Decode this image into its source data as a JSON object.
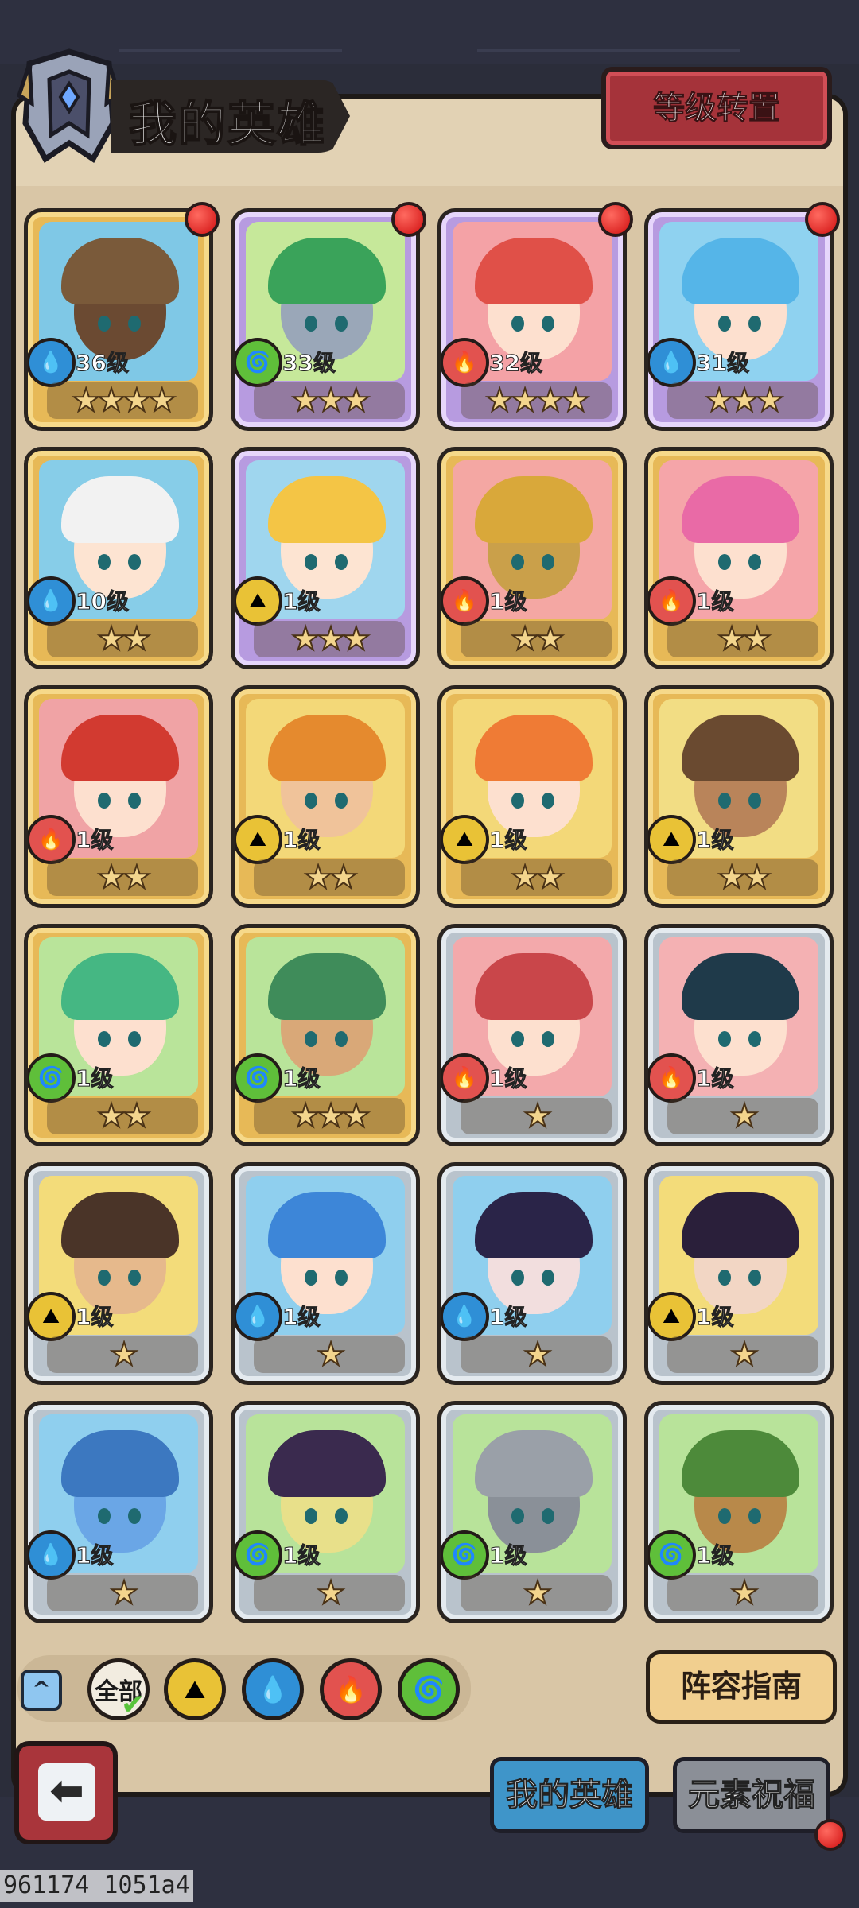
{
  "header": {
    "title": "我的英雄",
    "reset_button_label": "等级转置"
  },
  "elements": {
    "water": {
      "icon": "water-drop-icon",
      "color": "#2f8fd6",
      "glyph": "💧"
    },
    "wind": {
      "icon": "wind-swirl-icon",
      "color": "#5fbf3a",
      "glyph": "🌀"
    },
    "fire": {
      "icon": "fire-flame-icon",
      "color": "#e2524f",
      "glyph": "🔥"
    },
    "earth": {
      "icon": "earth-mound-icon",
      "color": "#e9c236",
      "glyph": "⛰"
    }
  },
  "heroes": [
    {
      "level": "36级",
      "stars": 4,
      "element": "water",
      "frame": "gold",
      "notify": true,
      "hair": "#7a5a3a",
      "bg": "#7fc8e6",
      "skin": "#6b4a32"
    },
    {
      "level": "33级",
      "stars": 3,
      "element": "wind",
      "frame": "purple",
      "notify": true,
      "hair": "#3aa35a",
      "bg": "#c6e89a",
      "skin": "#9aa7b8"
    },
    {
      "level": "32级",
      "stars": 4,
      "element": "fire",
      "frame": "purple",
      "notify": true,
      "hair": "#e05048",
      "bg": "#f4a2a6",
      "skin": "#fde0cf"
    },
    {
      "level": "31级",
      "stars": 3,
      "element": "water",
      "frame": "purple",
      "notify": true,
      "hair": "#55b5e8",
      "bg": "#8fd2f0",
      "skin": "#fde0cf"
    },
    {
      "level": "10级",
      "stars": 2,
      "element": "water",
      "frame": "gold",
      "notify": false,
      "hair": "#f2f2f2",
      "bg": "#87cde8",
      "skin": "#fde4d2"
    },
    {
      "level": "1级",
      "stars": 3,
      "element": "earth",
      "frame": "purple",
      "notify": false,
      "hair": "#f4c545",
      "bg": "#9fd6ee",
      "skin": "#fde4d2"
    },
    {
      "level": "1级",
      "stars": 2,
      "element": "fire",
      "frame": "gold",
      "notify": false,
      "hair": "#d9a83a",
      "bg": "#f4a7a3",
      "skin": "#caa04a"
    },
    {
      "level": "1级",
      "stars": 2,
      "element": "fire",
      "frame": "gold",
      "notify": false,
      "hair": "#e96aa6",
      "bg": "#f5a5a9",
      "skin": "#fde0cf"
    },
    {
      "level": "1级",
      "stars": 2,
      "element": "fire",
      "frame": "gold",
      "notify": false,
      "hair": "#d23a30",
      "bg": "#f0a3a5",
      "skin": "#fde0cf"
    },
    {
      "level": "1级",
      "stars": 2,
      "element": "earth",
      "frame": "gold",
      "notify": false,
      "hair": "#e58a2e",
      "bg": "#f3d878",
      "skin": "#f0c39a"
    },
    {
      "level": "1级",
      "stars": 2,
      "element": "earth",
      "frame": "gold",
      "notify": false,
      "hair": "#ef7b35",
      "bg": "#f3d878",
      "skin": "#fde0cf"
    },
    {
      "level": "1级",
      "stars": 2,
      "element": "earth",
      "frame": "gold",
      "notify": false,
      "hair": "#6a4a30",
      "bg": "#f2dd84",
      "skin": "#b9845a"
    },
    {
      "level": "1级",
      "stars": 2,
      "element": "wind",
      "frame": "gold",
      "notify": false,
      "hair": "#45b783",
      "bg": "#b9e49a",
      "skin": "#fde0cf"
    },
    {
      "level": "1级",
      "stars": 3,
      "element": "wind",
      "frame": "gold",
      "notify": false,
      "hair": "#3f8c5a",
      "bg": "#b9e49a",
      "skin": "#d9a878"
    },
    {
      "level": "1级",
      "stars": 1,
      "element": "fire",
      "frame": "silver",
      "notify": false,
      "hair": "#c9464a",
      "bg": "#f3a9ab",
      "skin": "#fde0cf"
    },
    {
      "level": "1级",
      "stars": 1,
      "element": "fire",
      "frame": "silver",
      "notify": false,
      "hair": "#1f3a4a",
      "bg": "#f4b1b3",
      "skin": "#fde0cf"
    },
    {
      "level": "1级",
      "stars": 1,
      "element": "earth",
      "frame": "silver",
      "notify": false,
      "hair": "#4a3428",
      "bg": "#f3dc7a",
      "skin": "#e6b98c"
    },
    {
      "level": "1级",
      "stars": 1,
      "element": "water",
      "frame": "silver",
      "notify": false,
      "hair": "#3d86d8",
      "bg": "#8fcfee",
      "skin": "#fde0cf"
    },
    {
      "level": "1级",
      "stars": 1,
      "element": "water",
      "frame": "silver",
      "notify": false,
      "hair": "#2a2448",
      "bg": "#8fcfee",
      "skin": "#f2dede"
    },
    {
      "level": "1级",
      "stars": 1,
      "element": "earth",
      "frame": "silver",
      "notify": false,
      "hair": "#2a1f3a",
      "bg": "#f3dc7a",
      "skin": "#f2d6c4"
    },
    {
      "level": "1级",
      "stars": 1,
      "element": "water",
      "frame": "silver",
      "notify": false,
      "hair": "#3c78c0",
      "bg": "#8fcfee",
      "skin": "#6aa6e6"
    },
    {
      "level": "1级",
      "stars": 1,
      "element": "wind",
      "frame": "silver",
      "notify": false,
      "hair": "#3a2a4e",
      "bg": "#b8e39a",
      "skin": "#e8e08a"
    },
    {
      "level": "1级",
      "stars": 1,
      "element": "wind",
      "frame": "silver",
      "notify": false,
      "hair": "#9aa0a8",
      "bg": "#b8e39a",
      "skin": "#8a9098"
    },
    {
      "level": "1级",
      "stars": 1,
      "element": "wind",
      "frame": "silver",
      "notify": false,
      "hair": "#4d8a3a",
      "bg": "#b8e39a",
      "skin": "#b8894a"
    }
  ],
  "filters": {
    "all_label": "全部",
    "items": [
      "earth",
      "water",
      "fire",
      "wind"
    ]
  },
  "guide_button_label": "阵容指南",
  "back_icon": "back-arrow-icon",
  "tabs": {
    "my_heroes": "我的英雄",
    "element_blessing": "元素祝福"
  },
  "debug_overlay": "961174 1051a4"
}
